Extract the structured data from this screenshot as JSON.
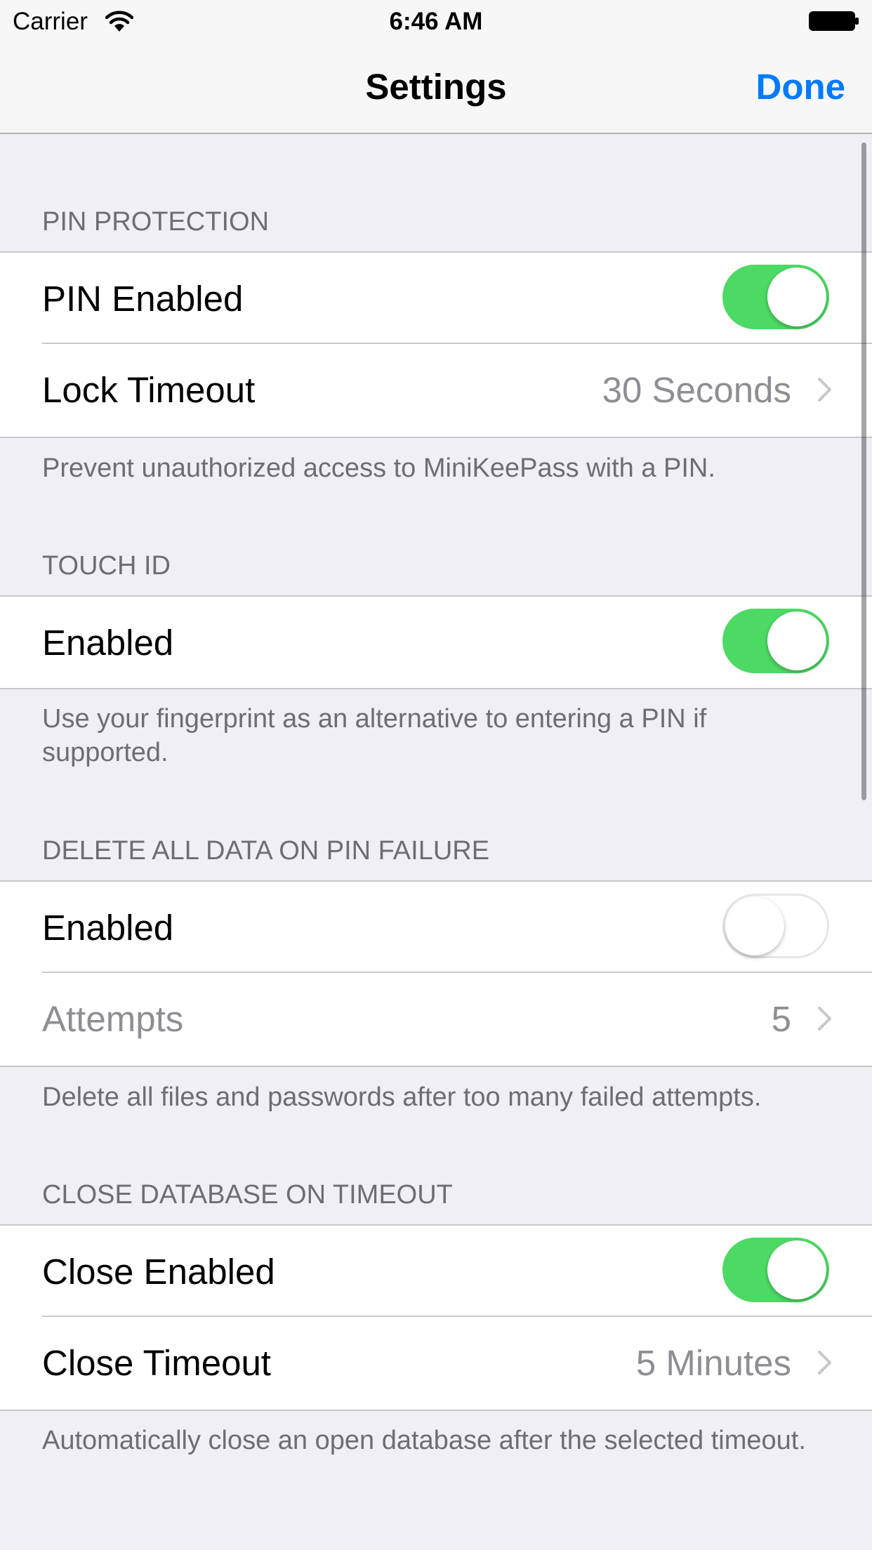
{
  "status_bar": {
    "carrier": "Carrier",
    "time": "6:46 AM",
    "wifi_icon": "wifi-icon",
    "battery_icon": "battery-icon"
  },
  "nav": {
    "title": "Settings",
    "done_label": "Done",
    "accent_color": "#007aff"
  },
  "colors": {
    "switch_on": "#4cd964",
    "background": "#efeff4"
  },
  "sections": [
    {
      "header": "PIN PROTECTION",
      "rows": [
        {
          "label": "PIN Enabled",
          "type": "switch",
          "on": true
        },
        {
          "label": "Lock Timeout",
          "type": "disclosure",
          "value": "30 Seconds"
        }
      ],
      "footer": "Prevent unauthorized access to MiniKeePass with a PIN."
    },
    {
      "header": "TOUCH ID",
      "rows": [
        {
          "label": "Enabled",
          "type": "switch",
          "on": true
        }
      ],
      "footer": "Use your fingerprint as an alternative to entering a PIN if supported."
    },
    {
      "header": "DELETE ALL DATA ON PIN FAILURE",
      "rows": [
        {
          "label": "Enabled",
          "type": "switch",
          "on": false
        },
        {
          "label": "Attempts",
          "type": "disclosure",
          "value": "5",
          "disabled": true
        }
      ],
      "footer": "Delete all files and passwords after too many failed attempts."
    },
    {
      "header": "CLOSE DATABASE ON TIMEOUT",
      "rows": [
        {
          "label": "Close Enabled",
          "type": "switch",
          "on": true
        },
        {
          "label": "Close Timeout",
          "type": "disclosure",
          "value": "5 Minutes"
        }
      ],
      "footer": "Automatically close an open database after the selected timeout."
    }
  ]
}
